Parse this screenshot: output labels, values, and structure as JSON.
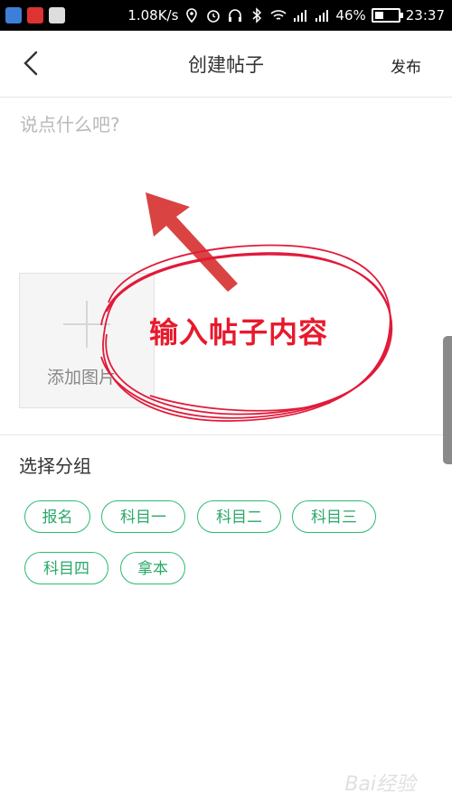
{
  "status_bar": {
    "speed": "1.08K/s",
    "battery_percent": "46%",
    "battery_level": 0.46,
    "time": "23:37"
  },
  "header": {
    "title": "创建帖子",
    "publish_label": "发布"
  },
  "editor": {
    "placeholder": "说点什么吧?"
  },
  "add_image": {
    "label": "添加图片"
  },
  "annotation": {
    "text": "输入帖子内容"
  },
  "group": {
    "title": "选择分组",
    "tags": [
      "报名",
      "科目一",
      "科目二",
      "科目三",
      "科目四",
      "拿本"
    ]
  },
  "colors": {
    "accent_green": "#2dbb73",
    "annotation_red": "#e8192c"
  },
  "watermark": "Bai经验"
}
